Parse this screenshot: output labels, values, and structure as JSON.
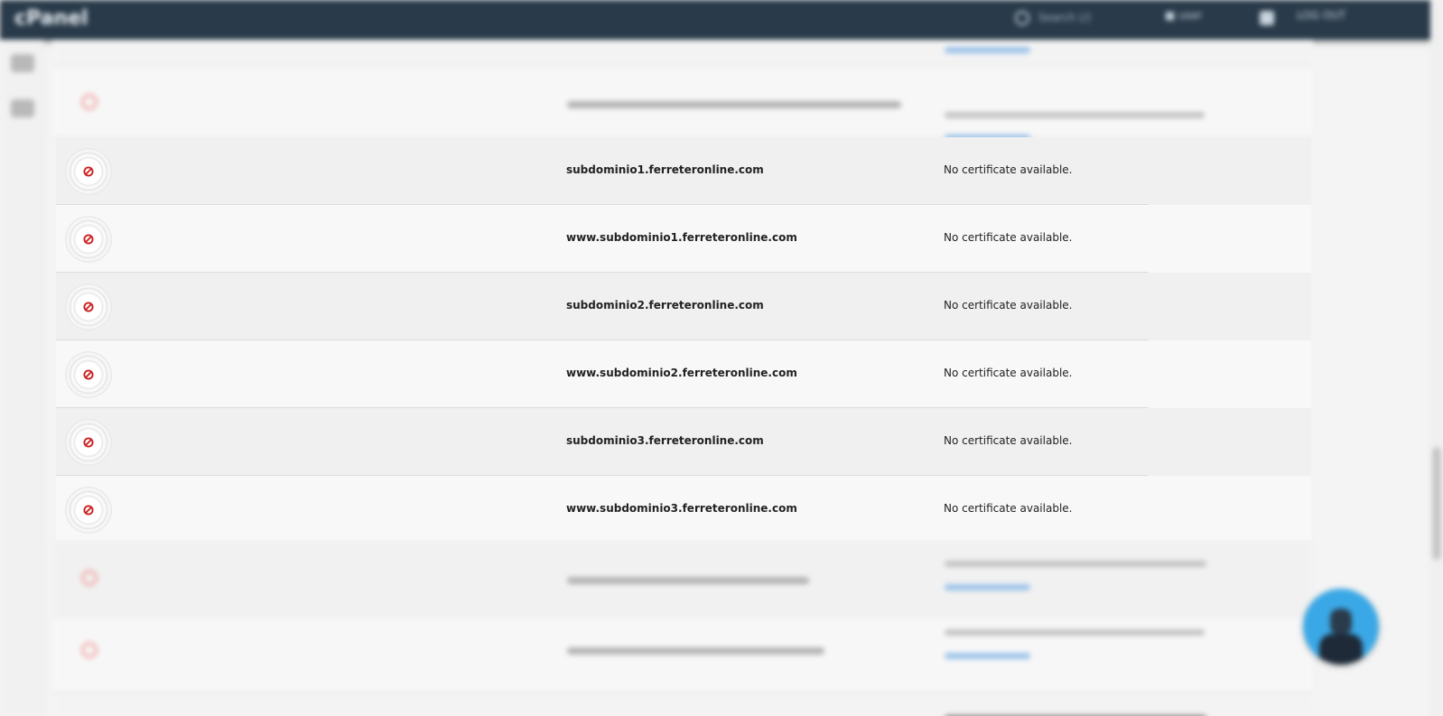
{
  "header": {
    "brand": "cPanel",
    "search_placeholder": "Search (/)",
    "user_label": "user",
    "logout_label": "LOG OUT"
  },
  "rows": [
    {
      "domain": "subdominio1.ferreteronline.com",
      "certificate": "No certificate available."
    },
    {
      "domain": "www.subdominio1.ferreteronline.com",
      "certificate": "No certificate available."
    },
    {
      "domain": "subdominio2.ferreteronline.com",
      "certificate": "No certificate available."
    },
    {
      "domain": "www.subdominio2.ferreteronline.com",
      "certificate": "No certificate available."
    },
    {
      "domain": "subdominio3.ferreteronline.com",
      "certificate": "No certificate available."
    },
    {
      "domain": "www.subdominio3.ferreteronline.com",
      "certificate": "No certificate available."
    }
  ],
  "icons": {
    "row_status": "ban-icon",
    "search": "search-icon",
    "user": "user-icon",
    "notifications": "bell-icon",
    "chat": "chat-avatar-icon"
  },
  "colors": {
    "topbar": "#293a4a",
    "ban_red": "#cc1f1f",
    "row_light": "#f8f8f8",
    "row_dark": "#f0f0f0",
    "chat_blue": "#3aa8e6"
  }
}
